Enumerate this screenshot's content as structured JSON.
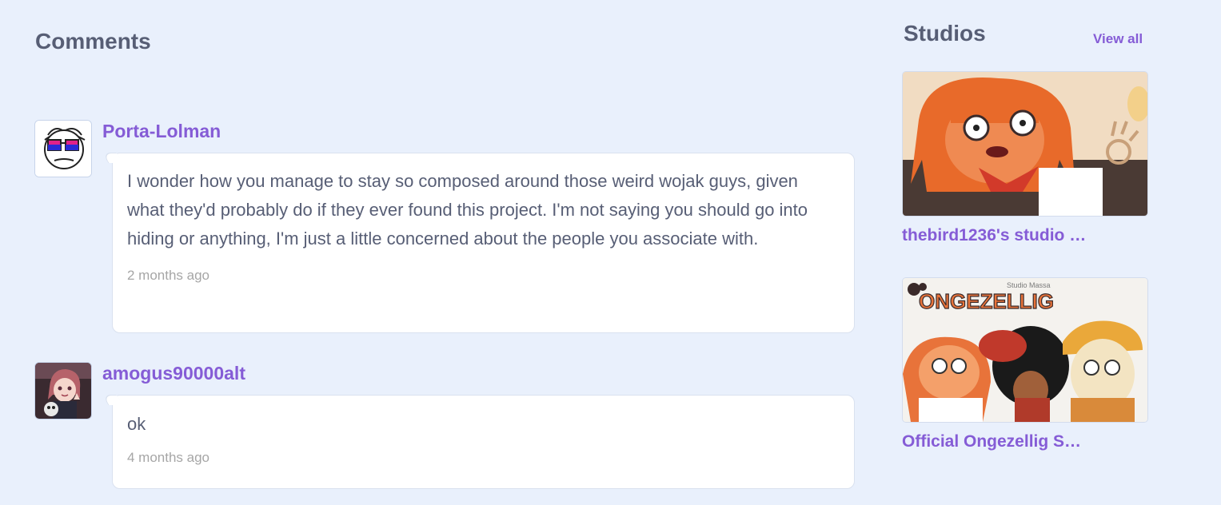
{
  "comments_section": {
    "title": "Comments",
    "comments": [
      {
        "username": "Porta-Lolman",
        "avatar": "doodle-face-with-bisexual-pride-glasses",
        "text": "I wonder how you manage to stay so composed around those weird wojak guys, given what they'd probably do if they ever found this project. I'm not saying you should go into hiding or anything, I'm just a little concerned about the people you associate with.",
        "time": "2 months ago"
      },
      {
        "username": "amogus90000alt",
        "avatar": "anime-girl-avatar",
        "text": "ok",
        "time": "4 months ago"
      }
    ]
  },
  "studios_section": {
    "title": "Studios",
    "view_all": "View all",
    "studios": [
      {
        "name": "thebird1236's studio …",
        "thumbnail": "orange-haired-cartoon-character"
      },
      {
        "name": "Official Ongezellig S…",
        "thumbnail": "ongezellig-logo-with-characters",
        "thumbnail_text": "ONGEZELLIG",
        "thumbnail_subtext": "Studio Massa"
      }
    ]
  },
  "colors": {
    "background": "#e9f0fc",
    "link": "#855cd6",
    "text": "#575e75",
    "muted": "#a6a6a6"
  }
}
